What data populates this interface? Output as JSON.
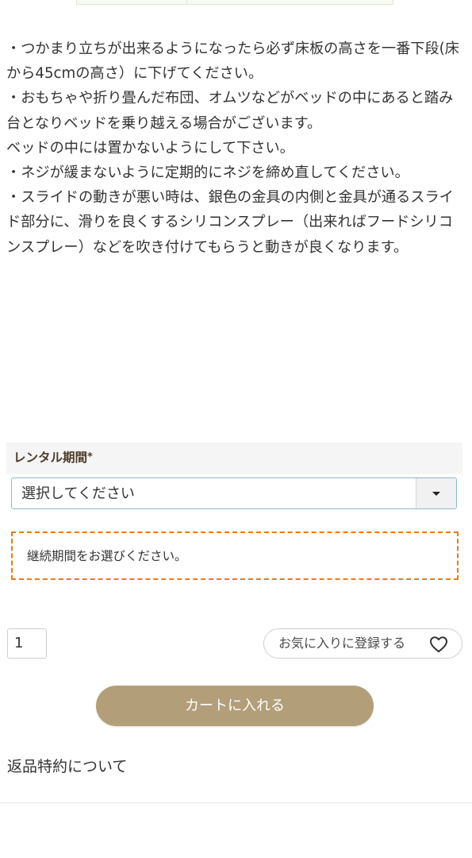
{
  "notes": {
    "lines": [
      "・つかまり立ちが出来るようになったら必ず床板の高さを一番下段(床から45cmの高さ）に下げてください。",
      "・おもちゃや折り畳んだ布団、オムツなどがベッドの中にあると踏み台となりベッドを乗り越える場合がございます。",
      "ベッドの中には置かないようにして下さい。",
      "・ネジが緩まないように定期的にネジを締め直してください。",
      "・スライドの動きが悪い時は、銀色の金具の内側と金具が通るスライド部分に、滑りを良くするシリコンスプレー（出来ればフードシリコンスプレー）などを吹き付けてもらうと動きが良くなります。"
    ]
  },
  "rental": {
    "label": "レンタル期間",
    "required_mark": "*",
    "select_value": "選択してください",
    "dropdown_icon": "chevron-down-icon",
    "notice": "継続期間をお選びください。"
  },
  "purchase": {
    "quantity": "1",
    "favorite_label": "お気に入りに登録する",
    "favorite_icon": "heart-icon",
    "cart_label": "カートに入れる"
  },
  "links": {
    "return_policy": "返品特約について"
  },
  "colors": {
    "cart_button": "#b29f7a",
    "notice_border": "#e87b16",
    "select_border": "#8fb7cc",
    "option_label": "#4b3b2a"
  }
}
